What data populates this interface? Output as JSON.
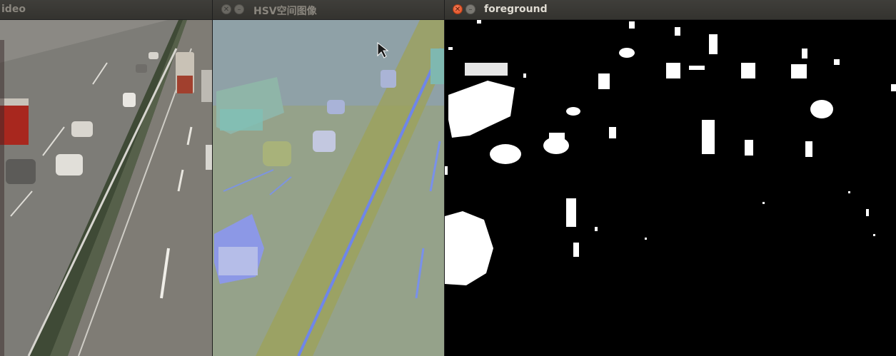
{
  "windows": [
    {
      "title": "ideo",
      "state": "inactive"
    },
    {
      "title": "HSV空间图像",
      "state": "inactive"
    },
    {
      "title": "foreground",
      "state": "active"
    }
  ],
  "icons": {
    "close": "close-icon",
    "minimize": "minimize-icon",
    "pointer": "mouse-pointer-icon"
  },
  "colors": {
    "titlebar": "#3c3b37",
    "close_active": "#e8542a",
    "foreground_bg": "#000000",
    "foreground_blobs": "#ffffff"
  }
}
